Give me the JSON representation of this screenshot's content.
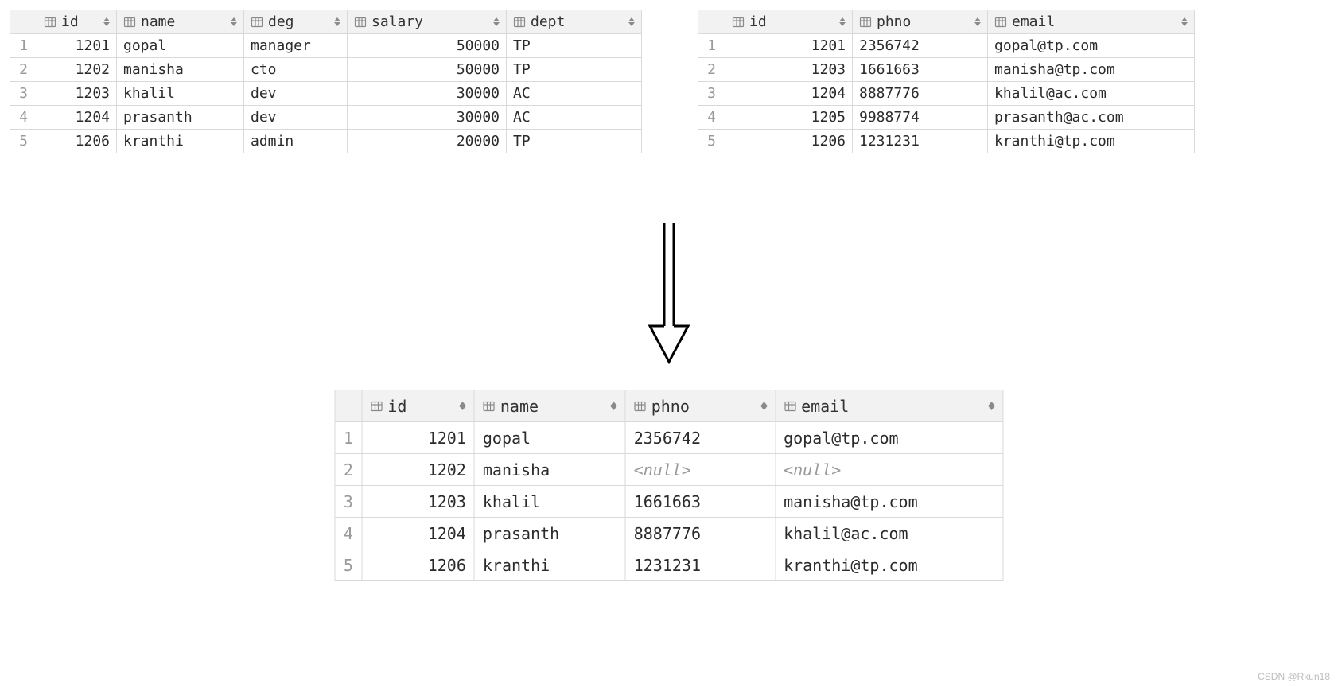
{
  "null_placeholder": "<null>",
  "watermark": "CSDN @Rkun18",
  "tables": {
    "employee": {
      "columns": [
        {
          "name": "id",
          "align": "num"
        },
        {
          "name": "name",
          "align": "txt"
        },
        {
          "name": "deg",
          "align": "txt"
        },
        {
          "name": "salary",
          "align": "num"
        },
        {
          "name": "dept",
          "align": "txt"
        }
      ],
      "rows": [
        {
          "id": "1201",
          "name": "gopal",
          "deg": "manager",
          "salary": "50000",
          "dept": "TP"
        },
        {
          "id": "1202",
          "name": "manisha",
          "deg": "cto",
          "salary": "50000",
          "dept": "TP"
        },
        {
          "id": "1203",
          "name": "khalil",
          "deg": "dev",
          "salary": "30000",
          "dept": "AC"
        },
        {
          "id": "1204",
          "name": "prasanth",
          "deg": "dev",
          "salary": "30000",
          "dept": "AC"
        },
        {
          "id": "1206",
          "name": "kranthi",
          "deg": "admin",
          "salary": "20000",
          "dept": "TP"
        }
      ]
    },
    "contact": {
      "columns": [
        {
          "name": "id",
          "align": "num"
        },
        {
          "name": "phno",
          "align": "txt"
        },
        {
          "name": "email",
          "align": "txt"
        }
      ],
      "rows": [
        {
          "id": "1201",
          "phno": "2356742",
          "email": "gopal@tp.com"
        },
        {
          "id": "1203",
          "phno": "1661663",
          "email": "manisha@tp.com"
        },
        {
          "id": "1204",
          "phno": "8887776",
          "email": "khalil@ac.com"
        },
        {
          "id": "1205",
          "phno": "9988774",
          "email": "prasanth@ac.com"
        },
        {
          "id": "1206",
          "phno": "1231231",
          "email": "kranthi@tp.com"
        }
      ]
    },
    "result": {
      "columns": [
        {
          "name": "id",
          "align": "num"
        },
        {
          "name": "name",
          "align": "txt"
        },
        {
          "name": "phno",
          "align": "txt"
        },
        {
          "name": "email",
          "align": "txt"
        }
      ],
      "rows": [
        {
          "id": "1201",
          "name": "gopal",
          "phno": "2356742",
          "email": "gopal@tp.com"
        },
        {
          "id": "1202",
          "name": "manisha",
          "phno": null,
          "email": null
        },
        {
          "id": "1203",
          "name": "khalil",
          "phno": "1661663",
          "email": "manisha@tp.com"
        },
        {
          "id": "1204",
          "name": "prasanth",
          "phno": "8887776",
          "email": "khalil@ac.com"
        },
        {
          "id": "1206",
          "name": "kranthi",
          "phno": "1231231",
          "email": "kranthi@tp.com"
        }
      ]
    }
  }
}
